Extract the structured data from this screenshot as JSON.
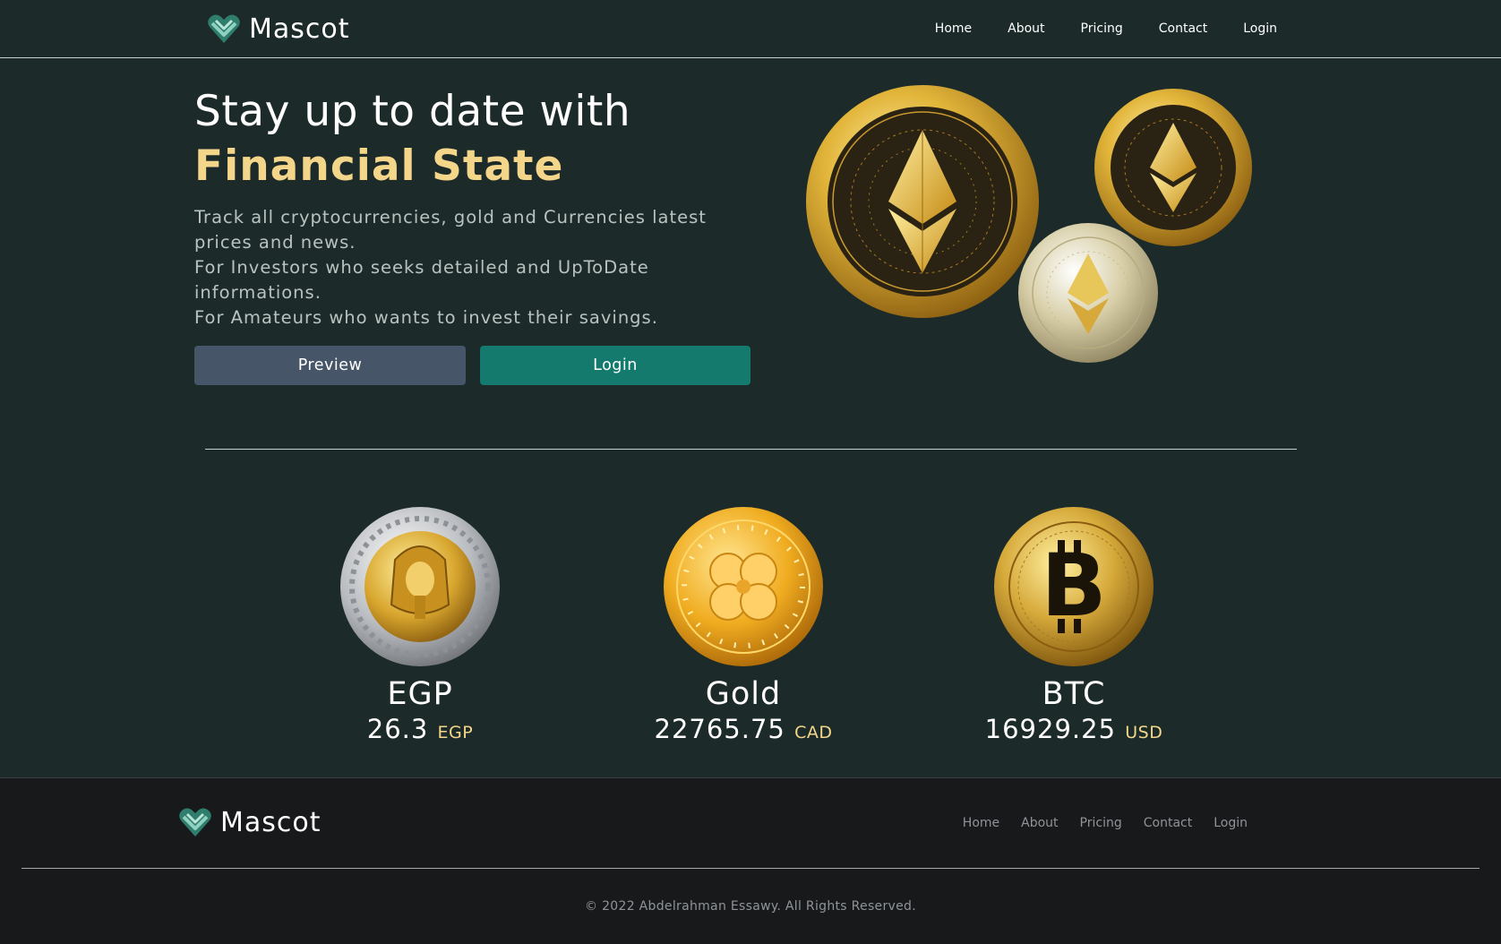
{
  "brand": {
    "name": "Mascot",
    "logo_icon": "heart-chevron-logo-icon"
  },
  "nav": {
    "items": [
      {
        "label": "Home"
      },
      {
        "label": "About"
      },
      {
        "label": "Pricing"
      },
      {
        "label": "Contact"
      },
      {
        "label": "Login"
      }
    ]
  },
  "hero": {
    "title_line1": "Stay up to date with",
    "title_line2": "Financial State",
    "desc": [
      "Track all cryptocurrencies, gold and Currencies latest prices and news.",
      "For Investors who seeks detailed and UpToDate informations.",
      "For Amateurs who wants to invest their savings."
    ],
    "preview_label": "Preview",
    "login_label": "Login"
  },
  "currencies": [
    {
      "name": "EGP",
      "price": "26.3",
      "unit": "EGP",
      "icon": "egyptian-pound-coin-icon"
    },
    {
      "name": "Gold",
      "price": "22765.75",
      "unit": "CAD",
      "icon": "gold-clover-coin-icon"
    },
    {
      "name": "BTC",
      "price": "16929.25",
      "unit": "USD",
      "icon": "bitcoin-coin-icon"
    }
  ],
  "footer": {
    "brand_name": "Mascot",
    "links": [
      {
        "label": "Home"
      },
      {
        "label": "About"
      },
      {
        "label": "Pricing"
      },
      {
        "label": "Contact"
      },
      {
        "label": "Login"
      }
    ],
    "copyright": "© 2022 Abdelrahman Essawy. All Rights Reserved."
  },
  "colors": {
    "background": "#1c2b29",
    "accent_gold": "#f4d68a",
    "preview_button": "#475569",
    "login_button": "#137a6d",
    "footer_bg": "#18191b"
  }
}
